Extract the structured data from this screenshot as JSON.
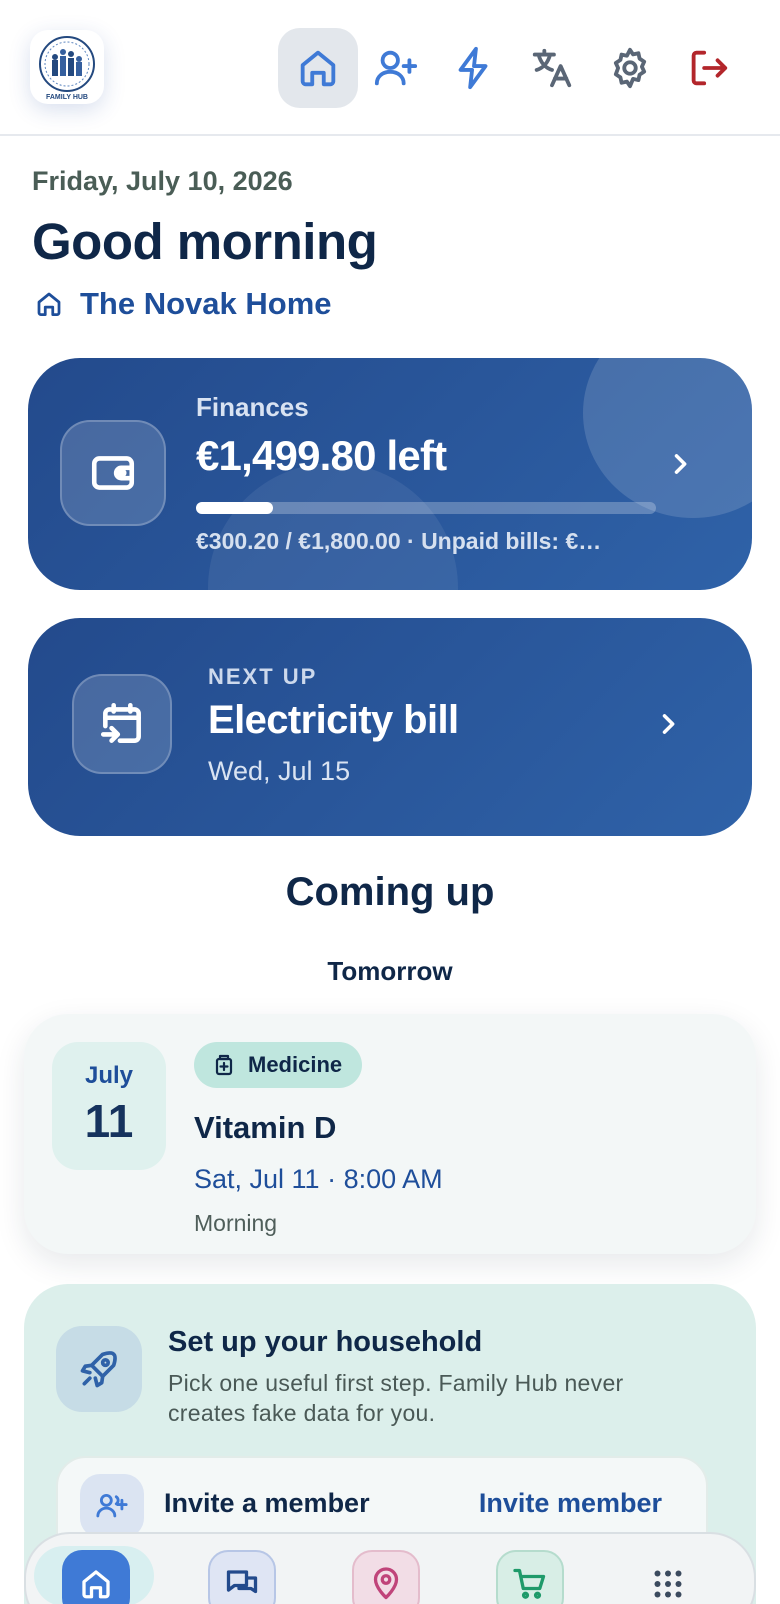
{
  "header": {
    "logo_text": "FAMILY HUB",
    "nav": [
      {
        "name": "home",
        "icon": "home-icon",
        "active": true
      },
      {
        "name": "add-member",
        "icon": "user-plus-icon"
      },
      {
        "name": "quick-actions",
        "icon": "lightning-icon"
      },
      {
        "name": "language",
        "icon": "translate-icon"
      },
      {
        "name": "settings",
        "icon": "gear-icon"
      },
      {
        "name": "logout",
        "icon": "logout-icon"
      }
    ]
  },
  "greeting": {
    "date": "Friday, July 10, 2026",
    "title": "Good morning",
    "home_name": "The Novak Home"
  },
  "finances": {
    "label": "Finances",
    "amount": "€1,499.80 left",
    "progress": 0.1667,
    "summary": "€300.20 / €1,800.00 · Unpaid bills: €…"
  },
  "next_up": {
    "label": "NEXT UP",
    "title": "Electricity bill",
    "date": "Wed, Jul 15"
  },
  "coming_up": {
    "heading": "Coming up",
    "group_label": "Tomorrow",
    "event": {
      "month": "July",
      "day": "11",
      "tag": "Medicine",
      "title": "Vitamin D",
      "when": "Sat, Jul 11 · 8:00 AM",
      "note": "Morning"
    }
  },
  "setup": {
    "title": "Set up your household",
    "description": "Pick one useful first step. Family Hub never creates fake data for you.",
    "invite_label": "Invite a member",
    "invite_action": "Invite member"
  },
  "bottom_nav": [
    {
      "name": "home",
      "icon": "home-icon",
      "active": true
    },
    {
      "name": "chat",
      "icon": "chat-icon"
    },
    {
      "name": "places",
      "icon": "map-pin-icon"
    },
    {
      "name": "shopping",
      "icon": "cart-icon"
    },
    {
      "name": "more",
      "icon": "grid-icon"
    }
  ],
  "colors": {
    "primary": "#1e4e9a",
    "card_blue": "#2f62a8",
    "logout_red": "#b3262b",
    "nav_blue": "#3f7ad6"
  }
}
